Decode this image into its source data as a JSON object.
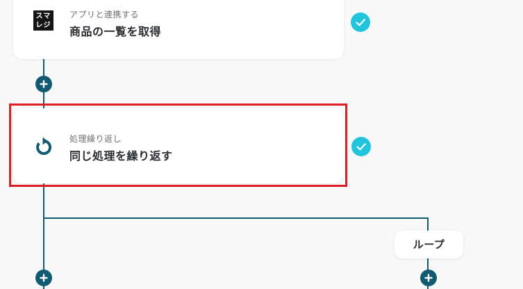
{
  "steps": [
    {
      "category": "アプリと連携する",
      "title": "商品の一覧を取得",
      "app_logo_text_line1": "スマ",
      "app_logo_text_line2": "レジ",
      "status": "completed",
      "icon": "smaregi-logo-icon"
    },
    {
      "category": "処理繰り返し",
      "title": "同じ処理を繰り返す",
      "status": "completed",
      "icon": "loop-arrow-icon"
    }
  ],
  "branch": {
    "label": "ループ"
  },
  "colors": {
    "connector": "#105a72",
    "check": "#22c3dc",
    "highlight": "#e11c24",
    "background": "#f8f8f9"
  }
}
